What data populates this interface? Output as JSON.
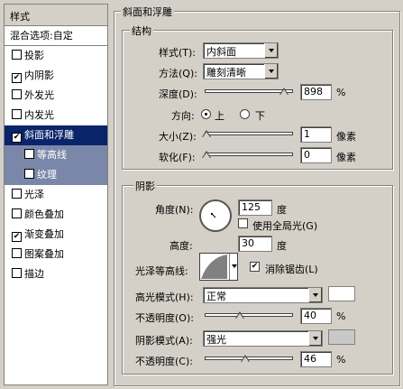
{
  "styles_panel": {
    "title": "样式",
    "blend_options": "混合选项:自定",
    "items": [
      {
        "label": "投影",
        "checked": false
      },
      {
        "label": "内阴影",
        "checked": true
      },
      {
        "label": "外发光",
        "checked": false
      },
      {
        "label": "内发光",
        "checked": false
      },
      {
        "label": "斜面和浮雕",
        "checked": true,
        "selected": true
      },
      {
        "label": "等高线",
        "checked": false,
        "sub": true
      },
      {
        "label": "纹理",
        "checked": false,
        "sub": true
      },
      {
        "label": "光泽",
        "checked": false
      },
      {
        "label": "颜色叠加",
        "checked": false
      },
      {
        "label": "渐变叠加",
        "checked": true
      },
      {
        "label": "图案叠加",
        "checked": false
      },
      {
        "label": "描边",
        "checked": false
      }
    ]
  },
  "bevel": {
    "title": "斜面和浮雕",
    "structure": {
      "title": "结构",
      "style_label": "样式(T):",
      "style_value": "内斜面",
      "method_label": "方法(Q):",
      "method_value": "雕刻清晰",
      "depth_label": "深度(D):",
      "depth_value": "898",
      "depth_unit": "%",
      "depth_fraction": 0.9,
      "direction_label": "方向:",
      "direction_up": "上",
      "direction_down": "下",
      "size_label": "大小(Z):",
      "size_value": "1",
      "size_unit": "像素",
      "soften_label": "软化(F):",
      "soften_value": "0",
      "soften_unit": "像素"
    },
    "shading": {
      "title": "阴影",
      "angle_label": "角度(N):",
      "angle_value": "125",
      "angle_unit": "度",
      "global_light_label": "使用全局光(G)",
      "global_light_checked": false,
      "altitude_label": "高度:",
      "altitude_value": "30",
      "altitude_unit": "度",
      "gloss_contour_label": "光泽等高线:",
      "anti_alias_label": "消除锯齿(L)",
      "anti_alias_checked": true,
      "highlight_mode_label": "高光模式(H):",
      "highlight_mode_value": "正常",
      "highlight_color": "#ffffff",
      "highlight_opacity_label": "不透明度(O):",
      "highlight_opacity_value": "40",
      "highlight_opacity_unit": "%",
      "shadow_mode_label": "阴影模式(A):",
      "shadow_mode_value": "强光",
      "shadow_color": "#c8c8c8",
      "shadow_opacity_label": "不透明度(C):",
      "shadow_opacity_value": "46",
      "shadow_opacity_unit": "%"
    }
  }
}
